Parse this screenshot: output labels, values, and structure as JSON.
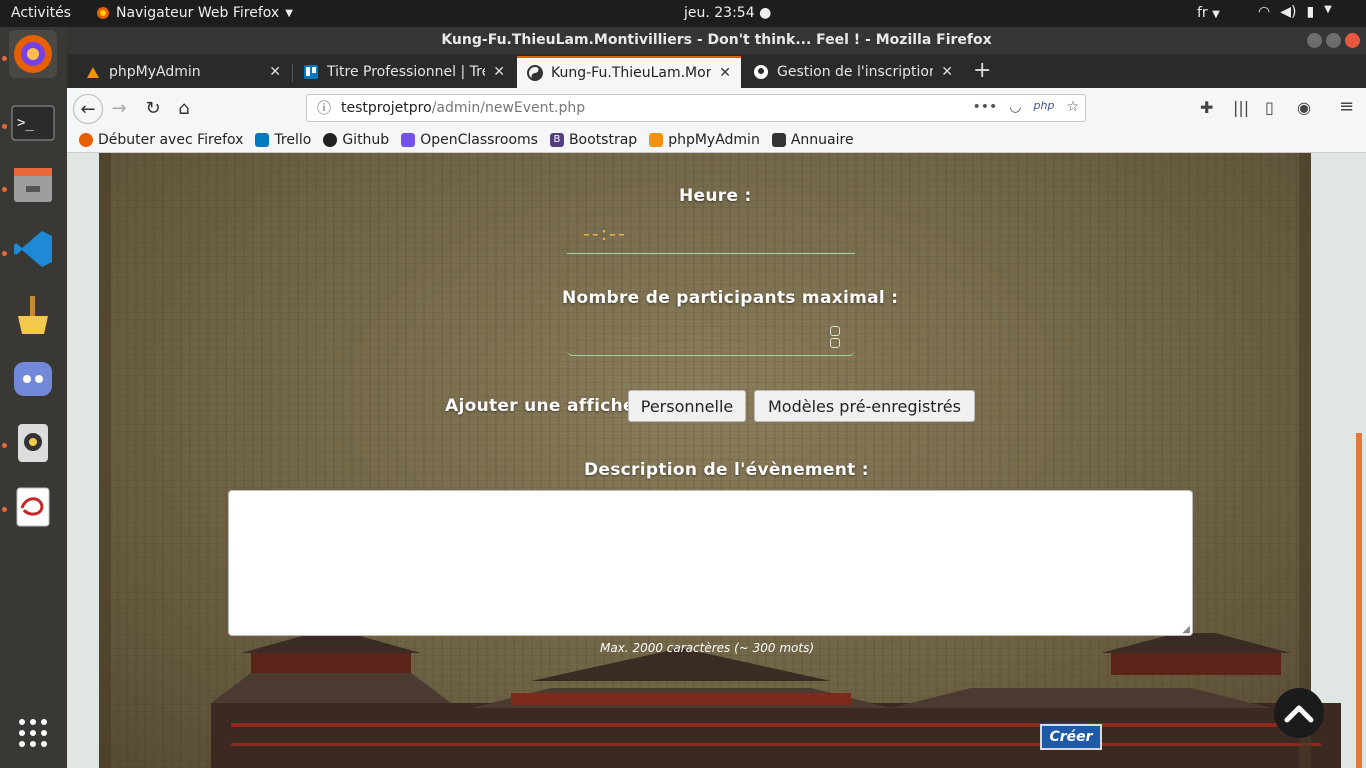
{
  "topbar": {
    "activities": "Activités",
    "app_name": "Navigateur Web Firefox",
    "clock": "jeu. 23:54",
    "lang": "fr"
  },
  "window": {
    "title": "Kung-Fu.ThieuLam.Montivilliers - Don't think... Feel ! - Mozilla Firefox"
  },
  "tabs": [
    {
      "label": "phpMyAdmin"
    },
    {
      "label": "Titre Professionnel | Trello"
    },
    {
      "label": "Kung-Fu.ThieuLam.Montivilliers"
    },
    {
      "label": "Gestion de l'inscription e"
    }
  ],
  "url": {
    "host": "testprojetpro",
    "path": "/admin/newEvent.php"
  },
  "bookmarks": [
    {
      "label": "Débuter avec Firefox",
      "color": "#e66000"
    },
    {
      "label": "Trello",
      "color": "#0079bf"
    },
    {
      "label": "Github",
      "color": "#222222"
    },
    {
      "label": "OpenClassrooms",
      "color": "#7451eb"
    },
    {
      "label": "Bootstrap",
      "color": "#563d7c"
    },
    {
      "label": "phpMyAdmin",
      "color": "#f29111"
    },
    {
      "label": "Annuaire",
      "color": "#333333"
    }
  ],
  "form": {
    "time_label": "Heure :",
    "time_placeholder": "--:--",
    "participants_label": "Nombre de participants maximal :",
    "poster_label": "Ajouter une affiche :",
    "personal_button": "Personnelle",
    "templates_button": "Modèles pré-enregistrés",
    "description_label": "Description de l'évènement :",
    "description_hint": "Max. 2000 caractères (~ 300 mots)",
    "create_button": "Créer"
  }
}
